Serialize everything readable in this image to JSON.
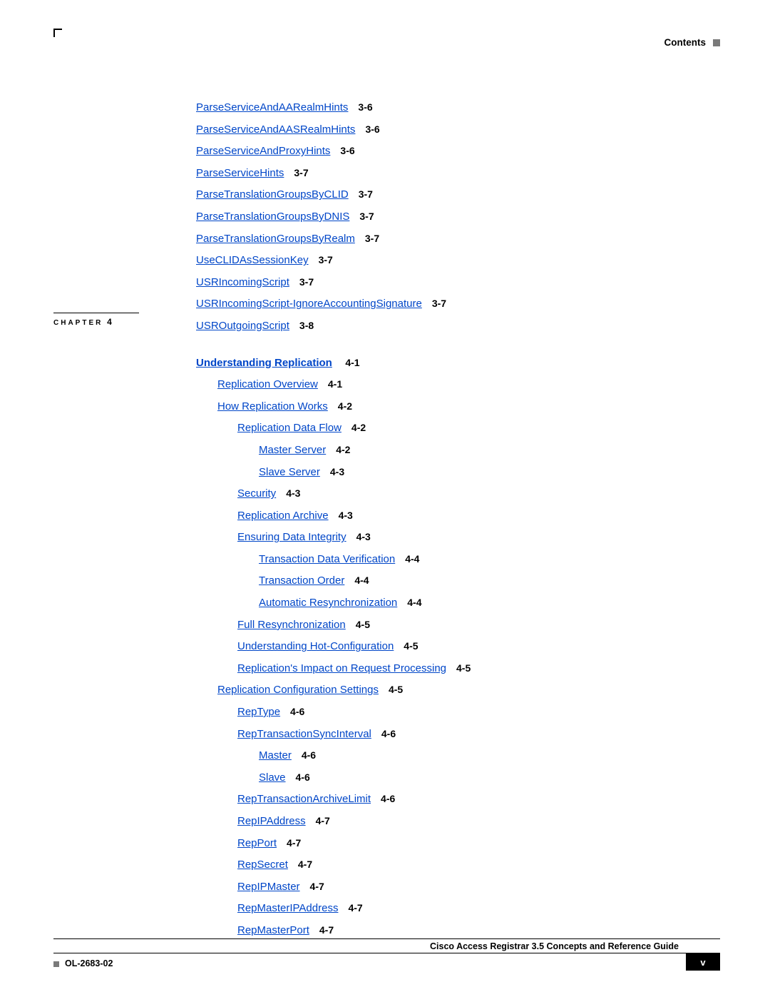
{
  "header": {
    "contents": "Contents"
  },
  "section1": [
    {
      "lvl": "l0",
      "label": "ParseServiceAndAARealmHints",
      "pg": "3-6"
    },
    {
      "lvl": "l0",
      "label": "ParseServiceAndAASRealmHints",
      "pg": "3-6"
    },
    {
      "lvl": "l0",
      "label": "ParseServiceAndProxyHints",
      "pg": "3-6"
    },
    {
      "lvl": "l0",
      "label": "ParseServiceHints",
      "pg": "3-7"
    },
    {
      "lvl": "l0",
      "label": "ParseTranslationGroupsByCLID",
      "pg": "3-7"
    },
    {
      "lvl": "l0",
      "label": "ParseTranslationGroupsByDNIS",
      "pg": "3-7"
    },
    {
      "lvl": "l0",
      "label": "ParseTranslationGroupsByRealm",
      "pg": "3-7"
    },
    {
      "lvl": "l0",
      "label": "UseCLIDAsSessionKey",
      "pg": "3-7"
    },
    {
      "lvl": "l0",
      "label": "USRIncomingScript",
      "pg": "3-7"
    },
    {
      "lvl": "l0",
      "label": "USRIncomingScript-IgnoreAccountingSignature",
      "pg": "3-7"
    },
    {
      "lvl": "l0",
      "label": "USROutgoingScript",
      "pg": "3-8"
    }
  ],
  "chapter": {
    "tag": "CHAPTER",
    "num": "4",
    "title": "Understanding Replication",
    "pg": "4-1"
  },
  "section2": [
    {
      "lvl": "l1",
      "label": "Replication Overview",
      "pg": "4-1"
    },
    {
      "lvl": "l1",
      "label": "How Replication Works",
      "pg": "4-2"
    },
    {
      "lvl": "l2",
      "label": "Replication Data Flow",
      "pg": "4-2"
    },
    {
      "lvl": "l3",
      "label": "Master Server",
      "pg": "4-2"
    },
    {
      "lvl": "l3",
      "label": "Slave Server",
      "pg": "4-3"
    },
    {
      "lvl": "l2",
      "label": "Security",
      "pg": "4-3"
    },
    {
      "lvl": "l2",
      "label": "Replication Archive",
      "pg": "4-3"
    },
    {
      "lvl": "l2",
      "label": "Ensuring Data Integrity",
      "pg": "4-3"
    },
    {
      "lvl": "l3",
      "label": "Transaction Data Verification",
      "pg": "4-4"
    },
    {
      "lvl": "l3",
      "label": "Transaction Order",
      "pg": "4-4"
    },
    {
      "lvl": "l3",
      "label": "Automatic Resynchronization",
      "pg": "4-4"
    },
    {
      "lvl": "l2",
      "label": "Full Resynchronization",
      "pg": "4-5"
    },
    {
      "lvl": "l2",
      "label": "Understanding Hot-Configuration",
      "pg": "4-5"
    },
    {
      "lvl": "l2",
      "label": "Replication's Impact on Request Processing",
      "pg": "4-5"
    },
    {
      "lvl": "l1",
      "label": "Replication Configuration Settings",
      "pg": "4-5"
    },
    {
      "lvl": "l2",
      "label": "RepType",
      "pg": "4-6"
    },
    {
      "lvl": "l2",
      "label": "RepTransactionSyncInterval",
      "pg": "4-6"
    },
    {
      "lvl": "l3",
      "label": "Master",
      "pg": "4-6"
    },
    {
      "lvl": "l3",
      "label": "Slave",
      "pg": "4-6"
    },
    {
      "lvl": "l2",
      "label": "RepTransactionArchiveLimit",
      "pg": "4-6"
    },
    {
      "lvl": "l2",
      "label": "RepIPAddress",
      "pg": "4-7"
    },
    {
      "lvl": "l2",
      "label": "RepPort",
      "pg": "4-7"
    },
    {
      "lvl": "l2",
      "label": "RepSecret",
      "pg": "4-7"
    },
    {
      "lvl": "l2",
      "label": "RepIPMaster",
      "pg": "4-7"
    },
    {
      "lvl": "l2",
      "label": "RepMasterIPAddress",
      "pg": "4-7"
    },
    {
      "lvl": "l2",
      "label": "RepMasterPort",
      "pg": "4-7"
    }
  ],
  "footer": {
    "title": "Cisco Access Registrar 3.5 Concepts and Reference Guide",
    "doc": "OL-2683-02",
    "page": "v"
  }
}
